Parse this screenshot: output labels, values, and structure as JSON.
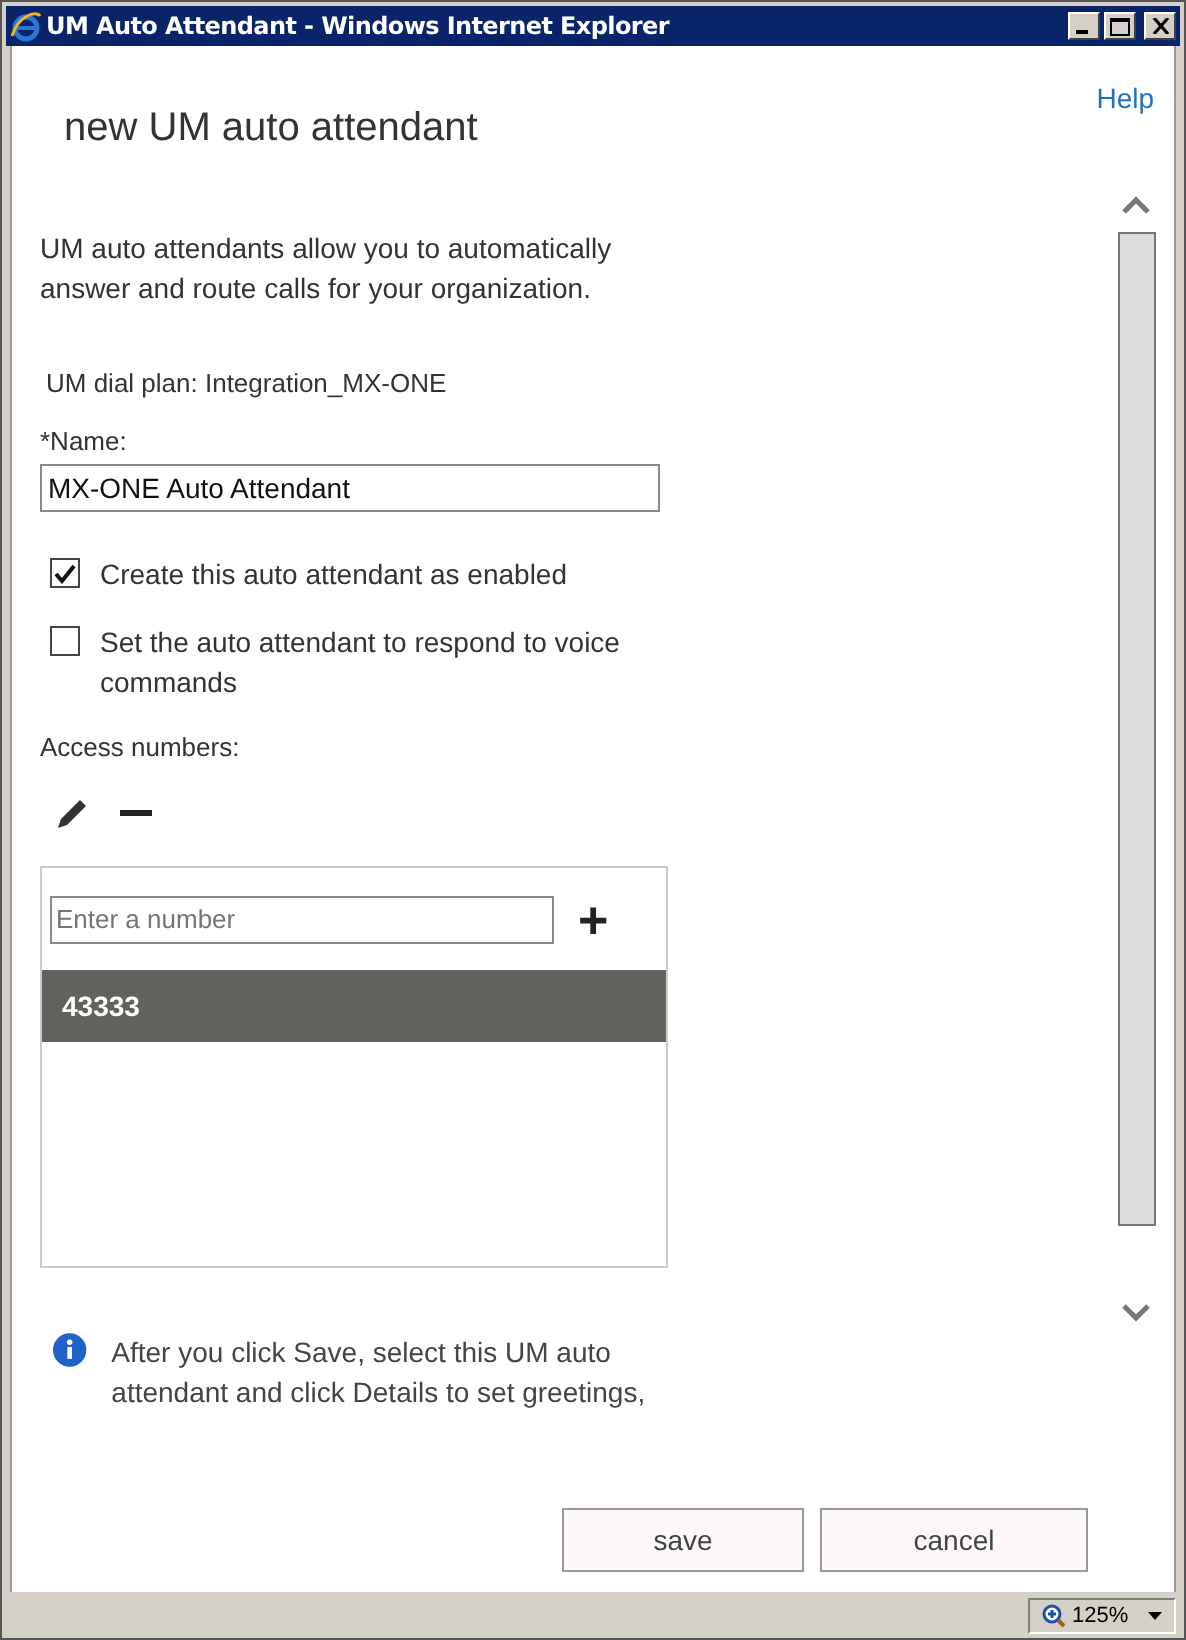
{
  "window": {
    "title": "UM Auto Attendant - Windows Internet Explorer"
  },
  "help_link": "Help",
  "heading": "new UM auto attendant",
  "description": "UM auto attendants allow you to automatically answer and route calls for your organization.",
  "dial_plan": "UM dial plan: Integration_MX-ONE",
  "name_field": {
    "label": "*Name:",
    "value": "MX-ONE Auto Attendant"
  },
  "options": [
    {
      "label": "Create this auto attendant as enabled",
      "checked": true
    },
    {
      "label": "Set the auto attendant to respond to voice commands",
      "checked": false
    }
  ],
  "access_numbers": {
    "label": "Access numbers:",
    "placeholder": "Enter a number",
    "add_button": "+",
    "items": [
      {
        "number": "43333",
        "selected": true
      }
    ]
  },
  "info_note": "After you click Save, select this UM auto attendant and click Details to set greetings,",
  "buttons": [
    "save",
    "cancel"
  ],
  "status_bar": {
    "zoom": "125%"
  }
}
